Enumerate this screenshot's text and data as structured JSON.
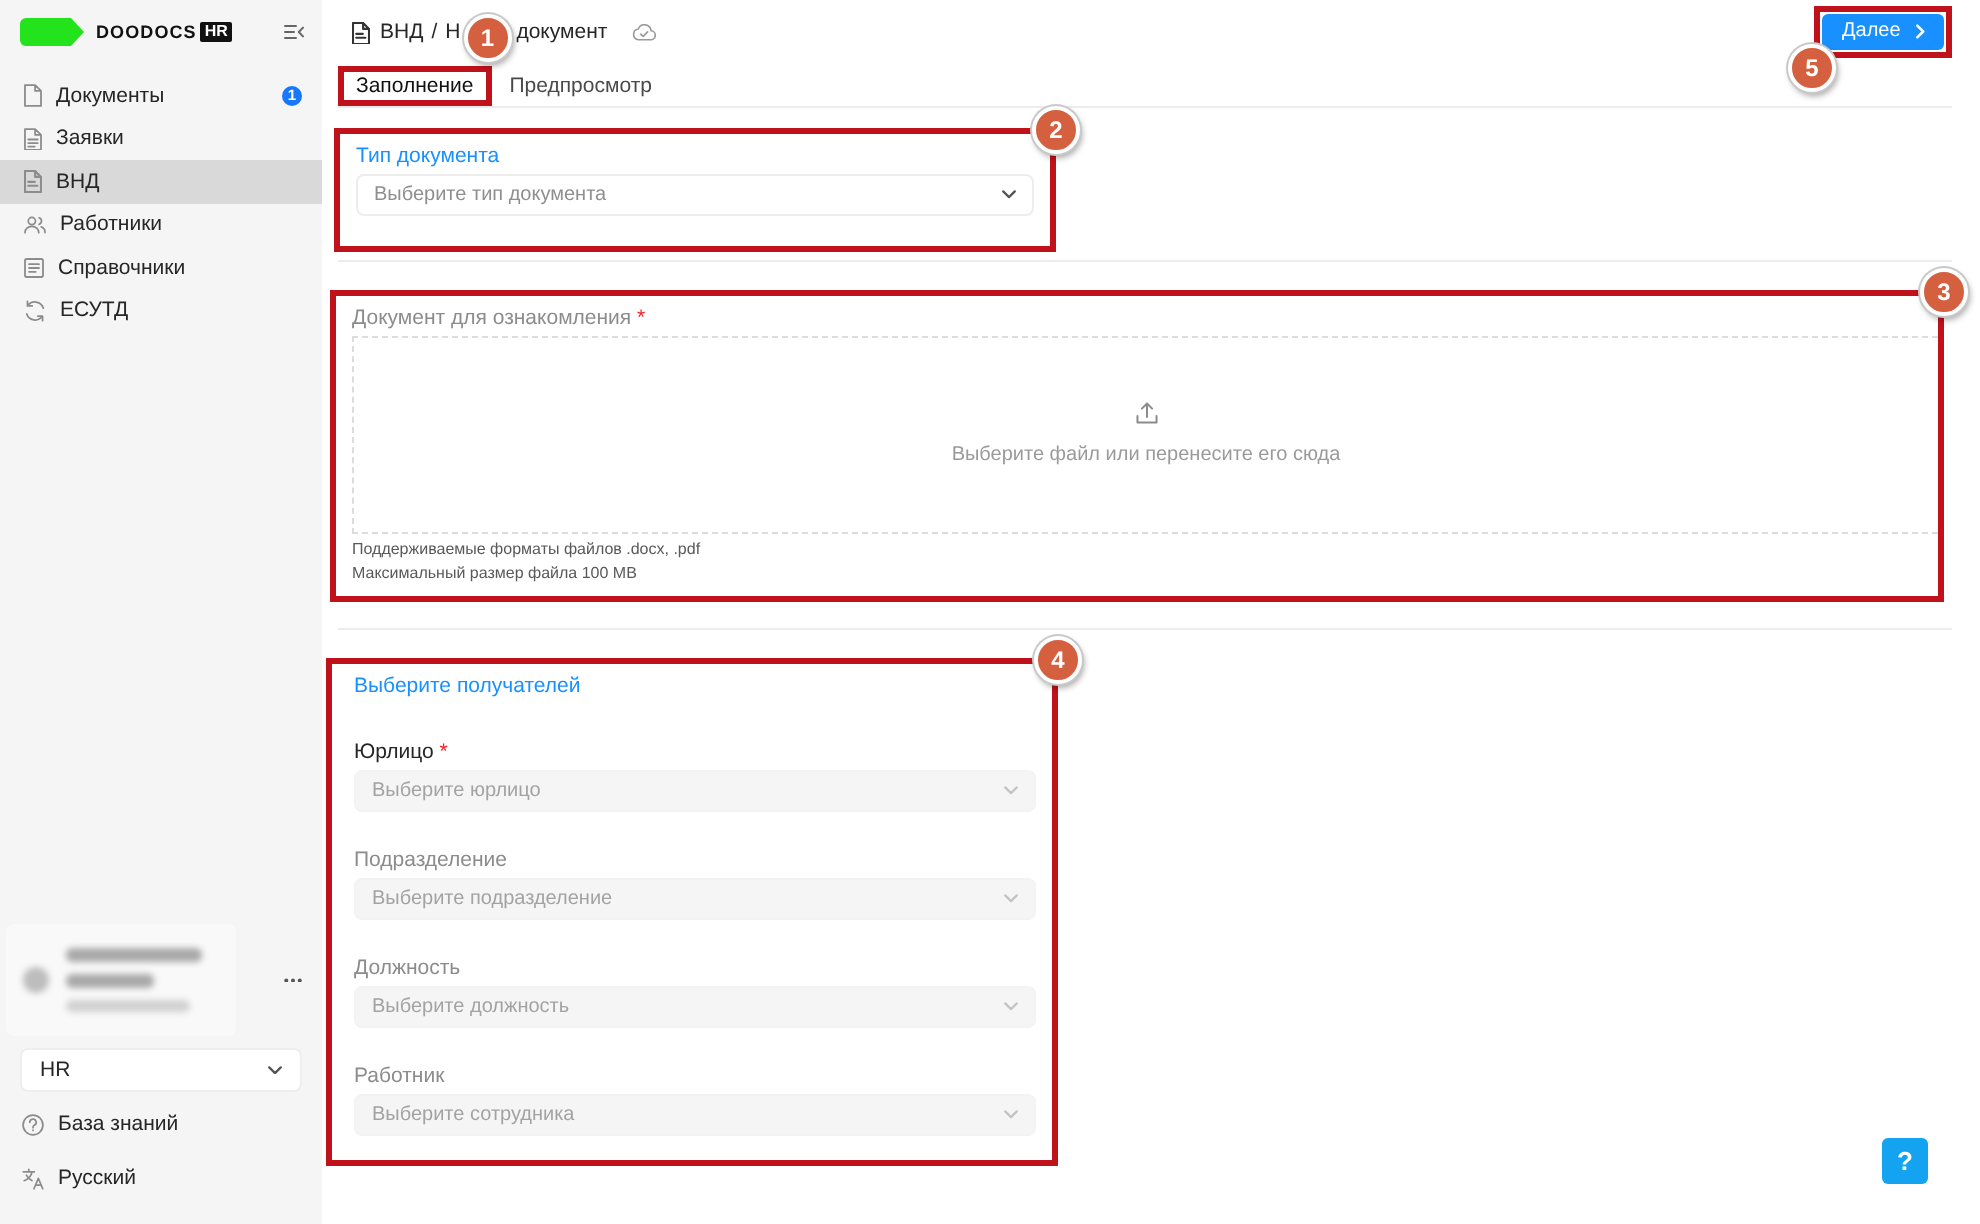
{
  "sidebar": {
    "logo": {
      "text": "DOODOCS",
      "tag": "HR"
    },
    "items": [
      {
        "label": "Документы",
        "badge": "1",
        "selected": false
      },
      {
        "label": "Заявки",
        "selected": false
      },
      {
        "label": "ВНД",
        "selected": true
      },
      {
        "label": "Работники",
        "selected": false
      },
      {
        "label": "Справочники",
        "selected": false
      },
      {
        "label": "ЕСУТД",
        "selected": false
      }
    ],
    "role_select": {
      "value": "HR"
    },
    "links": [
      {
        "label": "База знаний"
      },
      {
        "label": "Русский"
      }
    ]
  },
  "header": {
    "breadcrumb": {
      "parent": "ВНД",
      "separator": "/",
      "current_parts": [
        "Н",
        "документ"
      ]
    },
    "next_button": {
      "label": "Далее",
      "callout": "5"
    }
  },
  "tabs": [
    {
      "label": "Заполнение",
      "selected": true,
      "callout": "1"
    },
    {
      "label": "Предпросмотр",
      "selected": false
    }
  ],
  "sections": [
    {
      "kind": "select",
      "callout": "2",
      "label": "Тип документа",
      "label_highlighted": true,
      "placeholder": "Выберите тип документа",
      "disabled": false
    },
    {
      "kind": "upload",
      "callout": "3",
      "label": "Документ для ознакомления",
      "required_mark": "*",
      "label_dimmed": true,
      "dropzone_text": "Выберите файл или перенесите его сюда",
      "hints": [
        "Поддерживаемые форматы файлов .docx, .pdf",
        "Максимальный размер файла 100 MB"
      ]
    },
    {
      "kind": "recipients",
      "callout": "4",
      "title": "Выберите получателей",
      "fields": [
        {
          "label": "Юрлицо",
          "required_mark": "*",
          "label_dimmed": false,
          "placeholder": "Выберите юрлицо",
          "disabled": true
        },
        {
          "label": "Подразделение",
          "label_dimmed": true,
          "placeholder": "Выберите подразделение",
          "disabled": true
        },
        {
          "label": "Должность",
          "label_dimmed": true,
          "placeholder": "Выберите должность",
          "disabled": true
        },
        {
          "label": "Работник",
          "label_dimmed": true,
          "placeholder": "Выберите сотрудника",
          "disabled": true
        }
      ]
    }
  ],
  "help_button": {
    "label": "?"
  }
}
